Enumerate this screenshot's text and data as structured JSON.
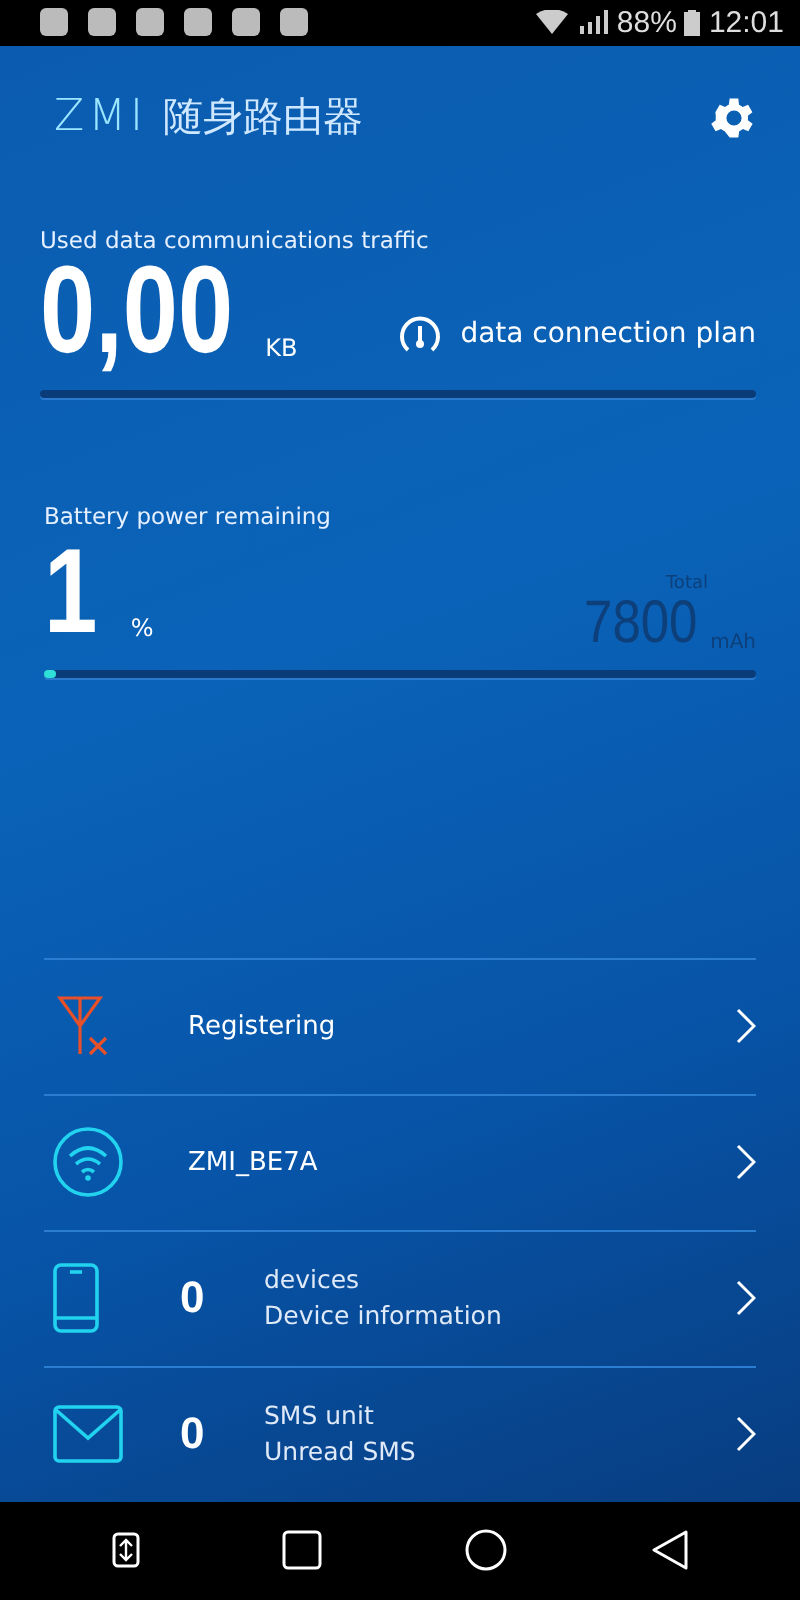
{
  "status_bar": {
    "battery": "88%",
    "time": "12:01"
  },
  "header": {
    "logo": "ZMI",
    "title": "随身路由器"
  },
  "traffic": {
    "label": "Used data communications traffic",
    "value": "0,00",
    "unit": "KB",
    "plan": "data connection plan"
  },
  "battery": {
    "label": "Battery power remaining",
    "value": "1",
    "unit": "%",
    "total_label": "Total",
    "total": "7800",
    "total_unit": "mAh",
    "level": 0.01
  },
  "rows": [
    {
      "kind": "signal",
      "title": "Registering"
    },
    {
      "kind": "wifi",
      "title": "ZMI_BE7A"
    },
    {
      "kind": "devices",
      "count": "0",
      "title": "devices",
      "subtitle": "Device information"
    },
    {
      "kind": "sms",
      "count": "0",
      "title": "SMS unit",
      "subtitle": "Unread SMS"
    }
  ]
}
